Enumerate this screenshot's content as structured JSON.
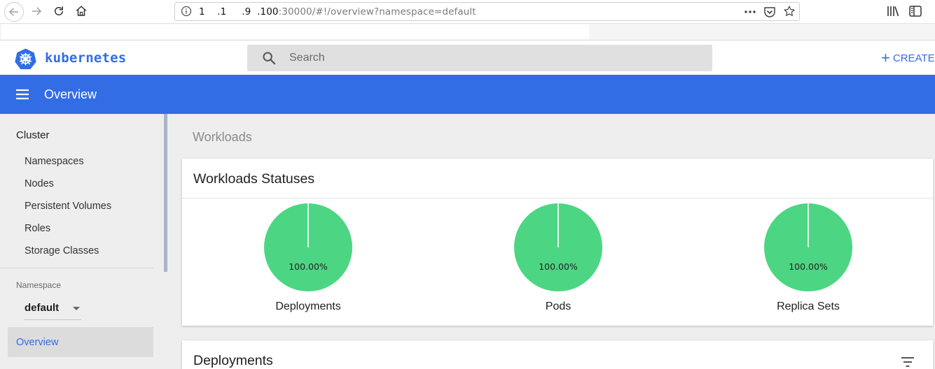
{
  "browser": {
    "url_host": "1    .1     .9  .100",
    "url_rest": ":30000/#!/overview?namespace=default"
  },
  "app": {
    "logo_text": "kubernetes",
    "search_placeholder": "Search",
    "create_label": "CREATE",
    "page_title": "Overview",
    "accent_color": "#326de6",
    "chart_color": "#4cd683"
  },
  "sidebar": {
    "cluster_heading": "Cluster",
    "cluster_items": [
      {
        "label": "Namespaces"
      },
      {
        "label": "Nodes"
      },
      {
        "label": "Persistent Volumes"
      },
      {
        "label": "Roles"
      },
      {
        "label": "Storage Classes"
      }
    ],
    "namespace_label": "Namespace",
    "namespace_value": "default",
    "active_item": "Overview"
  },
  "main": {
    "section_title": "Workloads",
    "statuses_card": {
      "title": "Workloads Statuses",
      "charts": [
        {
          "label": "Deployments",
          "percent_text": "100.00%",
          "running_fraction": 1.0
        },
        {
          "label": "Pods",
          "percent_text": "100.00%",
          "running_fraction": 1.0
        },
        {
          "label": "Replica Sets",
          "percent_text": "100.00%",
          "running_fraction": 1.0
        }
      ]
    },
    "deployments_card": {
      "title": "Deployments"
    }
  },
  "icons": [
    "back-arrow-icon",
    "forward-arrow-icon",
    "reload-icon",
    "home-icon",
    "info-icon",
    "more-dots-icon",
    "pocket-icon",
    "star-icon",
    "library-icon",
    "sidebar-icon",
    "kubernetes-logo-icon",
    "search-icon",
    "plus-icon",
    "menu-icon",
    "chevron-down-icon",
    "filter-icon"
  ]
}
